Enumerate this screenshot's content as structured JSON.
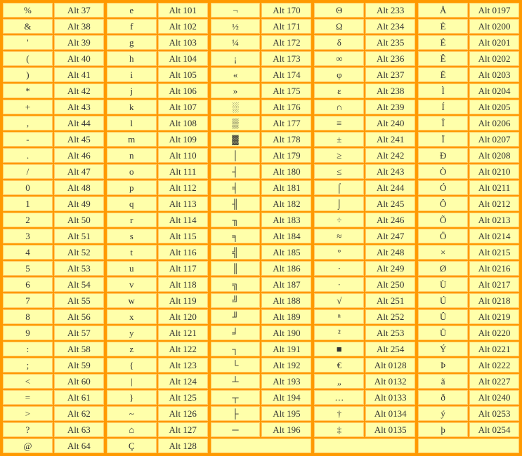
{
  "columns": [
    [
      {
        "sym": "%",
        "code": "Alt 37"
      },
      {
        "sym": "&",
        "code": "Alt 38"
      },
      {
        "sym": "'",
        "code": "Alt 39"
      },
      {
        "sym": "(",
        "code": "Alt 40"
      },
      {
        "sym": ")",
        "code": "Alt 41"
      },
      {
        "sym": "*",
        "code": "Alt 42"
      },
      {
        "sym": "+",
        "code": "Alt 43"
      },
      {
        "sym": ",",
        "code": "Alt 44"
      },
      {
        "sym": "-",
        "code": "Alt 45"
      },
      {
        "sym": ".",
        "code": "Alt 46"
      },
      {
        "sym": "/",
        "code": "Alt 47"
      },
      {
        "sym": "0",
        "code": "Alt 48"
      },
      {
        "sym": "1",
        "code": "Alt 49"
      },
      {
        "sym": "2",
        "code": "Alt 50"
      },
      {
        "sym": "3",
        "code": "Alt 51"
      },
      {
        "sym": "4",
        "code": "Alt 52"
      },
      {
        "sym": "5",
        "code": "Alt 53"
      },
      {
        "sym": "6",
        "code": "Alt 54"
      },
      {
        "sym": "7",
        "code": "Alt 55"
      },
      {
        "sym": "8",
        "code": "Alt 56"
      },
      {
        "sym": "9",
        "code": "Alt 57"
      },
      {
        "sym": ":",
        "code": "Alt 58"
      },
      {
        "sym": ";",
        "code": "Alt 59"
      },
      {
        "sym": "<",
        "code": "Alt 60"
      },
      {
        "sym": "=",
        "code": "Alt 61"
      },
      {
        "sym": ">",
        "code": "Alt 62"
      },
      {
        "sym": "?",
        "code": "Alt 63"
      },
      {
        "sym": "@",
        "code": "Alt 64"
      }
    ],
    [
      {
        "sym": "e",
        "code": "Alt 101"
      },
      {
        "sym": "f",
        "code": "Alt 102"
      },
      {
        "sym": "g",
        "code": "Alt 103"
      },
      {
        "sym": "h",
        "code": "Alt 104"
      },
      {
        "sym": "i",
        "code": "Alt 105"
      },
      {
        "sym": "j",
        "code": "Alt 106"
      },
      {
        "sym": "k",
        "code": "Alt 107"
      },
      {
        "sym": "l",
        "code": "Alt 108"
      },
      {
        "sym": "m",
        "code": "Alt 109"
      },
      {
        "sym": "n",
        "code": "Alt 110"
      },
      {
        "sym": "o",
        "code": "Alt 111"
      },
      {
        "sym": "p",
        "code": "Alt 112"
      },
      {
        "sym": "q",
        "code": "Alt 113"
      },
      {
        "sym": "r",
        "code": "Alt 114"
      },
      {
        "sym": "s",
        "code": "Alt 115"
      },
      {
        "sym": "t",
        "code": "Alt 116"
      },
      {
        "sym": "u",
        "code": "Alt 117"
      },
      {
        "sym": "v",
        "code": "Alt 118"
      },
      {
        "sym": "w",
        "code": "Alt 119"
      },
      {
        "sym": "x",
        "code": "Alt 120"
      },
      {
        "sym": "y",
        "code": "Alt 121"
      },
      {
        "sym": "z",
        "code": "Alt 122"
      },
      {
        "sym": "{",
        "code": "Alt 123"
      },
      {
        "sym": "|",
        "code": "Alt 124"
      },
      {
        "sym": "}",
        "code": "Alt 125"
      },
      {
        "sym": "~",
        "code": "Alt 126"
      },
      {
        "sym": "⌂",
        "code": "Alt 127"
      },
      {
        "sym": "Ç",
        "code": "Alt 128"
      }
    ],
    [
      {
        "sym": "¬",
        "code": "Alt 170"
      },
      {
        "sym": "½",
        "code": "Alt 171"
      },
      {
        "sym": "¼",
        "code": "Alt 172"
      },
      {
        "sym": "¡",
        "code": "Alt 173"
      },
      {
        "sym": "«",
        "code": "Alt 174"
      },
      {
        "sym": "»",
        "code": "Alt 175"
      },
      {
        "sym": "░",
        "code": "Alt 176"
      },
      {
        "sym": "▒",
        "code": "Alt 177"
      },
      {
        "sym": "▓",
        "code": "Alt 178"
      },
      {
        "sym": "│",
        "code": "Alt 179"
      },
      {
        "sym": "┤",
        "code": "Alt 180"
      },
      {
        "sym": "╡",
        "code": "Alt 181"
      },
      {
        "sym": "╢",
        "code": "Alt 182"
      },
      {
        "sym": "╖",
        "code": "Alt 183"
      },
      {
        "sym": "╕",
        "code": "Alt 184"
      },
      {
        "sym": "╣",
        "code": "Alt 185"
      },
      {
        "sym": "║",
        "code": "Alt 186"
      },
      {
        "sym": "╗",
        "code": "Alt 187"
      },
      {
        "sym": "╝",
        "code": "Alt 188"
      },
      {
        "sym": "╜",
        "code": "Alt 189"
      },
      {
        "sym": "╛",
        "code": "Alt 190"
      },
      {
        "sym": "┐",
        "code": "Alt 191"
      },
      {
        "sym": "└",
        "code": "Alt 192"
      },
      {
        "sym": "┴",
        "code": "Alt 193"
      },
      {
        "sym": "┬",
        "code": "Alt 194"
      },
      {
        "sym": "├",
        "code": "Alt 195"
      },
      {
        "sym": "─",
        "code": "Alt 196"
      },
      {
        "empty": true
      }
    ],
    [
      {
        "sym": "Θ",
        "code": "Alt 233"
      },
      {
        "sym": "Ω",
        "code": "Alt 234"
      },
      {
        "sym": "δ",
        "code": "Alt 235"
      },
      {
        "sym": "∞",
        "code": "Alt 236"
      },
      {
        "sym": "φ",
        "code": "Alt 237"
      },
      {
        "sym": "ε",
        "code": "Alt 238"
      },
      {
        "sym": "∩",
        "code": "Alt 239"
      },
      {
        "sym": "≡",
        "code": "Alt 240"
      },
      {
        "sym": "±",
        "code": "Alt 241"
      },
      {
        "sym": "≥",
        "code": "Alt 242"
      },
      {
        "sym": "≤",
        "code": "Alt 243"
      },
      {
        "sym": "⌠",
        "code": "Alt 244"
      },
      {
        "sym": "⌡",
        "code": "Alt 245"
      },
      {
        "sym": "÷",
        "code": "Alt 246"
      },
      {
        "sym": "≈",
        "code": "Alt 247"
      },
      {
        "sym": "°",
        "code": "Alt 248"
      },
      {
        "sym": "∙",
        "code": "Alt 249"
      },
      {
        "sym": "·",
        "code": "Alt 250"
      },
      {
        "sym": "√",
        "code": "Alt 251"
      },
      {
        "sym": "ⁿ",
        "code": "Alt 252"
      },
      {
        "sym": "²",
        "code": "Alt 253"
      },
      {
        "sym": "■",
        "code": "Alt 254"
      },
      {
        "sym": "€",
        "code": "Alt 0128"
      },
      {
        "sym": "„",
        "code": "Alt 0132"
      },
      {
        "sym": "…",
        "code": "Alt 0133"
      },
      {
        "sym": "†",
        "code": "Alt 0134"
      },
      {
        "sym": "‡",
        "code": "Alt 0135"
      },
      {
        "empty": true
      }
    ],
    [
      {
        "sym": "Å",
        "code": "Alt 0197"
      },
      {
        "sym": "È",
        "code": "Alt 0200"
      },
      {
        "sym": "É",
        "code": "Alt 0201"
      },
      {
        "sym": "Ê",
        "code": "Alt 0202"
      },
      {
        "sym": "Ë",
        "code": "Alt 0203"
      },
      {
        "sym": "Ì",
        "code": "Alt 0204"
      },
      {
        "sym": "Í",
        "code": "Alt 0205"
      },
      {
        "sym": "Î",
        "code": "Alt 0206"
      },
      {
        "sym": "Ï",
        "code": "Alt 0207"
      },
      {
        "sym": "Ð",
        "code": "Alt 0208"
      },
      {
        "sym": "Ò",
        "code": "Alt 0210"
      },
      {
        "sym": "Ó",
        "code": "Alt 0211"
      },
      {
        "sym": "Ô",
        "code": "Alt 0212"
      },
      {
        "sym": "Õ",
        "code": "Alt 0213"
      },
      {
        "sym": "Ö",
        "code": "Alt 0214"
      },
      {
        "sym": "×",
        "code": "Alt 0215"
      },
      {
        "sym": "Ø",
        "code": "Alt 0216"
      },
      {
        "sym": "Ù",
        "code": "Alt 0217"
      },
      {
        "sym": "Ú",
        "code": "Alt 0218"
      },
      {
        "sym": "Û",
        "code": "Alt 0219"
      },
      {
        "sym": "Ü",
        "code": "Alt 0220"
      },
      {
        "sym": "Ý",
        "code": "Alt 0221"
      },
      {
        "sym": "Þ",
        "code": "Alt 0222"
      },
      {
        "sym": "ã",
        "code": "Alt 0227"
      },
      {
        "sym": "ð",
        "code": "Alt 0240"
      },
      {
        "sym": "ý",
        "code": "Alt 0253"
      },
      {
        "sym": "þ",
        "code": "Alt 0254"
      },
      {
        "empty": true
      }
    ]
  ]
}
